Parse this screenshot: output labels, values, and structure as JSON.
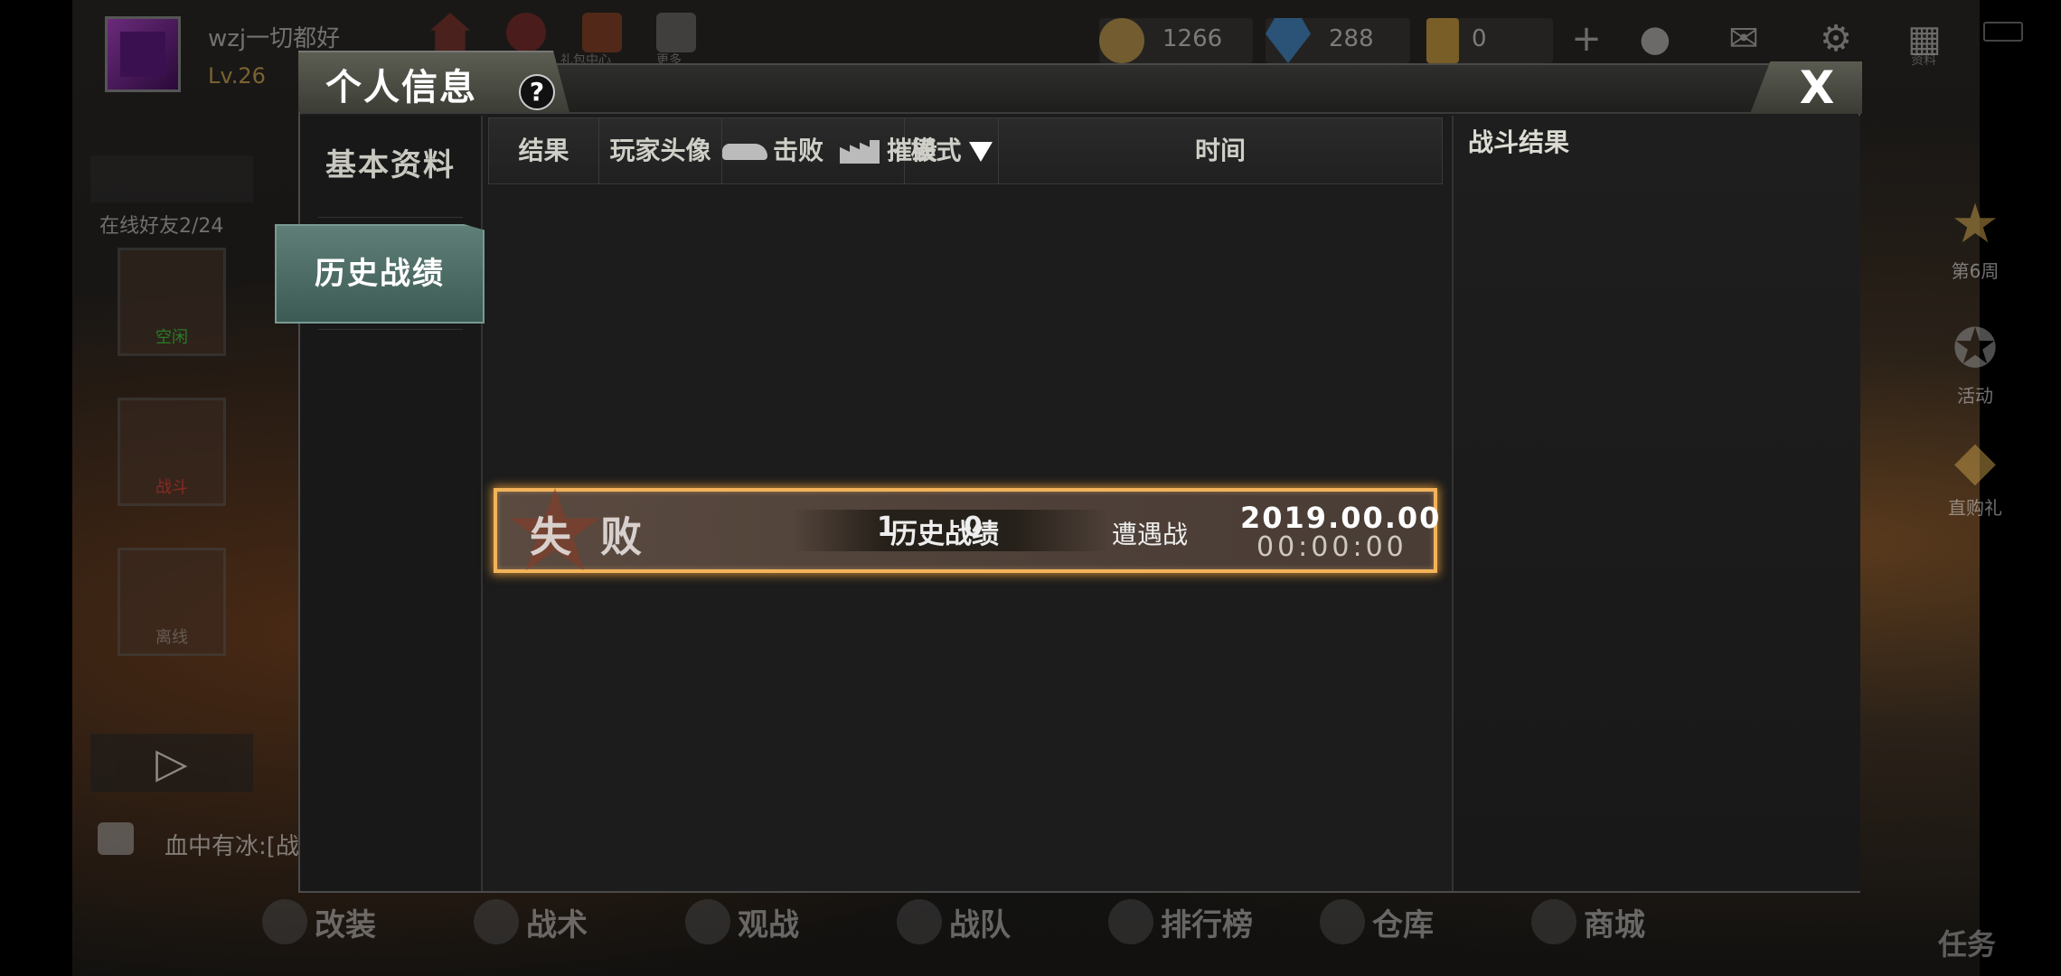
{
  "background": {
    "username": "wzj一切都好",
    "level": "Lv.26",
    "top_icons": [
      "home-icon",
      "penguin-icon",
      "gift-icon",
      "grid-icon"
    ],
    "top_icon_labels": [
      "",
      "",
      "礼包中心",
      "更多"
    ],
    "resources": [
      {
        "name": "gold-coin-icon",
        "value": "1266",
        "color": "#c9a04a"
      },
      {
        "name": "diamond-icon",
        "value": "288",
        "color": "#3a8ed8"
      },
      {
        "name": "card-icon",
        "value": "0",
        "color": "#d8a43a"
      }
    ],
    "friends_online": "在线好友2/24",
    "side_cards": [
      {
        "label": "空闲"
      },
      {
        "label": "战斗"
      },
      {
        "label": "离线"
      }
    ],
    "chat_text": "血中有冰:[战",
    "right_items": [
      {
        "label": "第6周"
      },
      {
        "label": "活动"
      },
      {
        "label": "直购礼"
      }
    ],
    "profile_label": "资料",
    "bottom_nav": [
      "改装",
      "战术",
      "观战",
      "战队",
      "排行榜",
      "仓库",
      "商城"
    ],
    "task_label": "任务"
  },
  "modal": {
    "title": "个人信息",
    "help": "?",
    "close": "X",
    "nav": [
      {
        "label": "基本资料",
        "active": false
      },
      {
        "label": "历史战绩",
        "active": true
      }
    ],
    "table_headers": {
      "result": "结果",
      "player_avatar": "玩家头像",
      "kills": "击败",
      "destroys": "摧毁",
      "mode": "模式",
      "time": "时间"
    },
    "rows": [
      {
        "result": "失 败",
        "kills": "1",
        "destroys": "0",
        "player": "历史战绩",
        "mode": "遭遇战",
        "date": "2019.00.00",
        "time": "00:00:00"
      }
    ],
    "detail_title": "战斗结果"
  },
  "colors": {
    "accent_gold": "#f3b35a",
    "nav_active": "#5f7f78",
    "row_bg": "#5a4a40"
  }
}
